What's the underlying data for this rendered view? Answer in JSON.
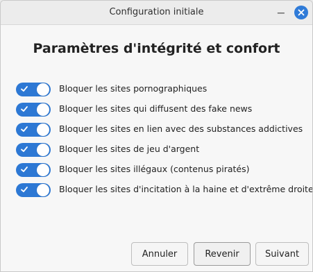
{
  "window": {
    "title": "Configuration initiale",
    "minimize_label": "−"
  },
  "heading": "Paramètres d'intégrité et confort",
  "options": [
    {
      "label": "Bloquer les sites pornographiques",
      "enabled": true
    },
    {
      "label": "Bloquer les sites qui diffusent des fake news",
      "enabled": true
    },
    {
      "label": "Bloquer les sites en lien avec des substances addictives",
      "enabled": true
    },
    {
      "label": "Bloquer les sites de jeu d'argent",
      "enabled": true
    },
    {
      "label": "Bloquer les sites illégaux (contenus piratés)",
      "enabled": true
    },
    {
      "label": "Bloquer les sites d'incitation à la haine et d'extrême droite",
      "enabled": true
    }
  ],
  "buttons": {
    "cancel": "Annuler",
    "back": "Revenir",
    "next": "Suivant"
  },
  "colors": {
    "accent": "#2d78d4",
    "close_button": "#2f7bd8"
  }
}
